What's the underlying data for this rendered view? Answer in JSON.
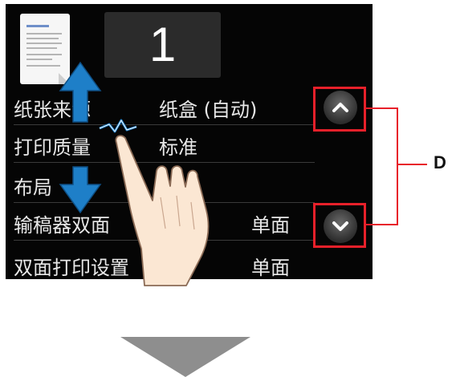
{
  "copies": "1",
  "settings": [
    {
      "label": "纸张来源",
      "value": "纸盒 (自动)"
    },
    {
      "label": "打印质量",
      "value": "标准"
    },
    {
      "label": "布局",
      "value": ""
    },
    {
      "label": "输稿器双面",
      "value": "单面"
    },
    {
      "label": "双面打印设置",
      "value": "单面"
    }
  ],
  "callout_label": "D",
  "icons": {
    "scroll_up": "chevron-up-icon",
    "scroll_down": "chevron-down-icon",
    "swipe_arrows": "up-down-arrow-icon",
    "hand": "pointing-hand-icon",
    "next": "down-arrow-icon"
  },
  "colors": {
    "screen_bg": "#050505",
    "highlight": "#e8202a",
    "arrow_blue": "#1e7fc8",
    "next_arrow": "#8e8e8e"
  }
}
